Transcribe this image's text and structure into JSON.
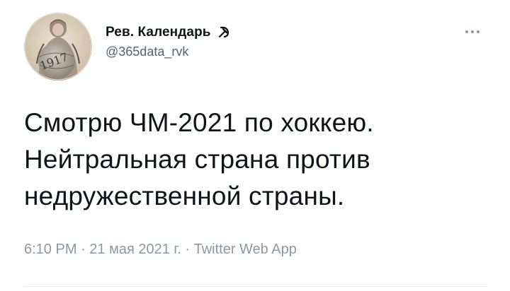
{
  "author": {
    "display_name": "Рев. Календарь",
    "badge_icon": "hammer-sickle-icon",
    "handle": "@365data_rvk",
    "avatar_text": "1917"
  },
  "tweet": {
    "lines": [
      "Смотрю ЧМ-2021 по хоккею.",
      "Нейтральная страна против",
      "недружественной страны."
    ],
    "time": "6:10 PM",
    "separator": "·",
    "date": "21 мая 2021 г.",
    "source": "Twitter Web App"
  },
  "menu": {
    "icon": "more-horizontal-icon"
  },
  "colors": {
    "text": "#0f1419",
    "secondary": "#536471",
    "meta": "#8899a6",
    "divider": "#e6ecf0"
  }
}
